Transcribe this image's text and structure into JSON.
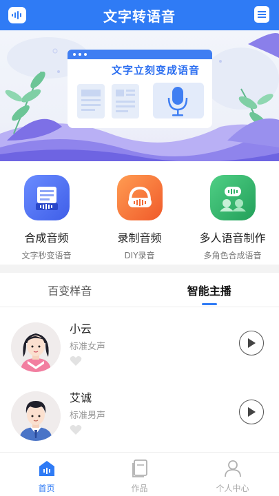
{
  "header": {
    "title": "文字转语音",
    "left_icon": "audio-wave-icon",
    "right_icon": "menu-icon",
    "color": "#2f7bf5"
  },
  "banner": {
    "card_text": "文字立刻变成语音",
    "illustration": "document-to-microphone-illustration"
  },
  "features": [
    {
      "name": "合成音频",
      "sub": "文字秒变语音",
      "icon": "document-audio-icon",
      "color": "#4a6cf2"
    },
    {
      "name": "录制音频",
      "sub": "DIY录音",
      "icon": "headphones-icon",
      "color": "#f6733c"
    },
    {
      "name": "多人语音制作",
      "sub": "多角色合成语音",
      "icon": "multi-speaker-icon",
      "color": "#34b36c"
    }
  ],
  "tabs": [
    {
      "label": "百变样音",
      "active": false
    },
    {
      "label": "智能主播",
      "active": true
    }
  ],
  "voices": [
    {
      "name": "小云",
      "desc": "标准女声",
      "avatar": "female-avatar",
      "icon": "play-icon"
    },
    {
      "name": "艾诚",
      "desc": "标准男声",
      "avatar": "male-avatar",
      "icon": "play-icon"
    }
  ],
  "bottom_nav": [
    {
      "label": "首页",
      "icon": "home-icon",
      "active": true
    },
    {
      "label": "作品",
      "icon": "works-icon",
      "active": false
    },
    {
      "label": "个人中心",
      "icon": "profile-icon",
      "active": false
    }
  ]
}
